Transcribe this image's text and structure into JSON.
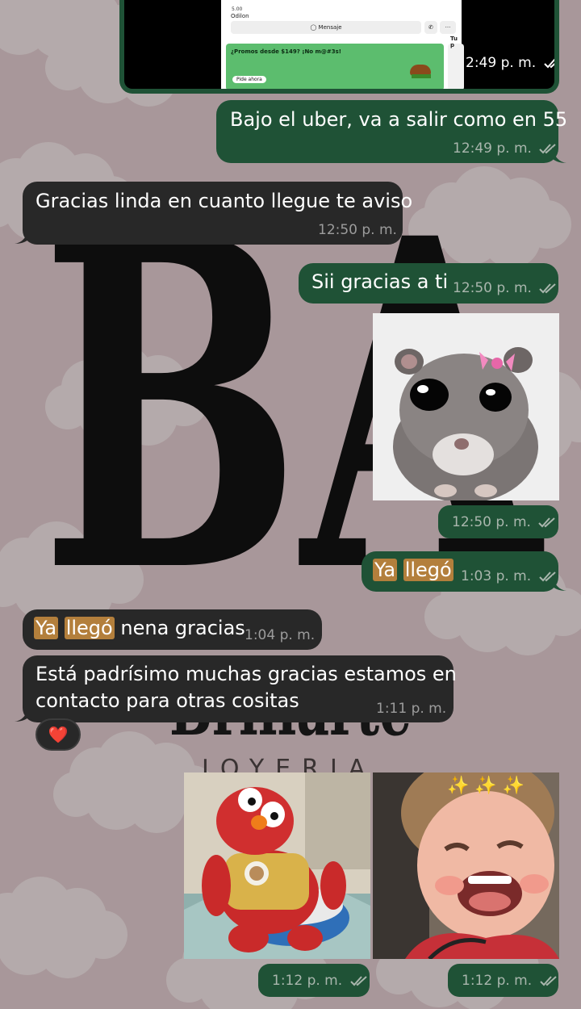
{
  "chat": {
    "messages": [
      {
        "id": "m1",
        "direction": "outgoing",
        "type": "screenshot",
        "time": "2:49 p. m.",
        "status": "read",
        "inner": {
          "author": "Odilon",
          "stars": "5.00",
          "message_button": "Mensaje",
          "promo_title": "¿Promos desde $149? ¡No m@#3s!",
          "promo_cta": "Pide ahora",
          "promo_cut": "Tu p"
        }
      },
      {
        "id": "m2",
        "direction": "outgoing",
        "type": "text",
        "text": "Bajo el uber, va a salir como en 55",
        "time": "12:49 p. m.",
        "status": "read"
      },
      {
        "id": "m3",
        "direction": "incoming",
        "type": "text",
        "text": "Gracias linda en cuanto llegue te aviso",
        "time": "12:50 p. m."
      },
      {
        "id": "m4",
        "direction": "outgoing",
        "type": "text",
        "text": "Sii gracias a ti",
        "time": "12:50 p. m.",
        "status": "read"
      },
      {
        "id": "m5",
        "direction": "outgoing",
        "type": "sticker",
        "sticker": "hamster-with-pink-bow",
        "time": "12:50 p. m.",
        "status": "read"
      },
      {
        "id": "m6",
        "direction": "outgoing",
        "type": "text",
        "highlight_1": "Ya",
        "highlight_2": "llegó",
        "time": "1:03 p. m.",
        "status": "read"
      },
      {
        "id": "m7",
        "direction": "incoming",
        "type": "text",
        "highlight_1": "Ya",
        "highlight_2": "llegó",
        "rest": "nena gracias",
        "time": "1:04 p. m."
      },
      {
        "id": "m8",
        "direction": "incoming",
        "type": "text",
        "line1": "Está padrísimo muchas gracias estamos en",
        "line2": "contacto para otras cositas",
        "time": "1:11 p. m.",
        "reaction": "❤️"
      },
      {
        "id": "m9",
        "direction": "outgoing",
        "type": "gif",
        "gif": "elmo-dancing",
        "time": "1:12 p. m.",
        "status": "read"
      },
      {
        "id": "m10",
        "direction": "outgoing",
        "type": "gif",
        "gif": "laughing-baby",
        "sparkles": "✨ ✨ ✨",
        "time": "1:12 p. m.",
        "status": "read"
      }
    ]
  },
  "wallpaper": {
    "letters": "BA",
    "brand": "Brillarte",
    "subtitle": "JOYERIA"
  },
  "colors": {
    "outgoing_bubble": "#1f5236",
    "incoming_bubble": "#282828",
    "background": "#a8979a",
    "highlight": "#b37f3c"
  }
}
